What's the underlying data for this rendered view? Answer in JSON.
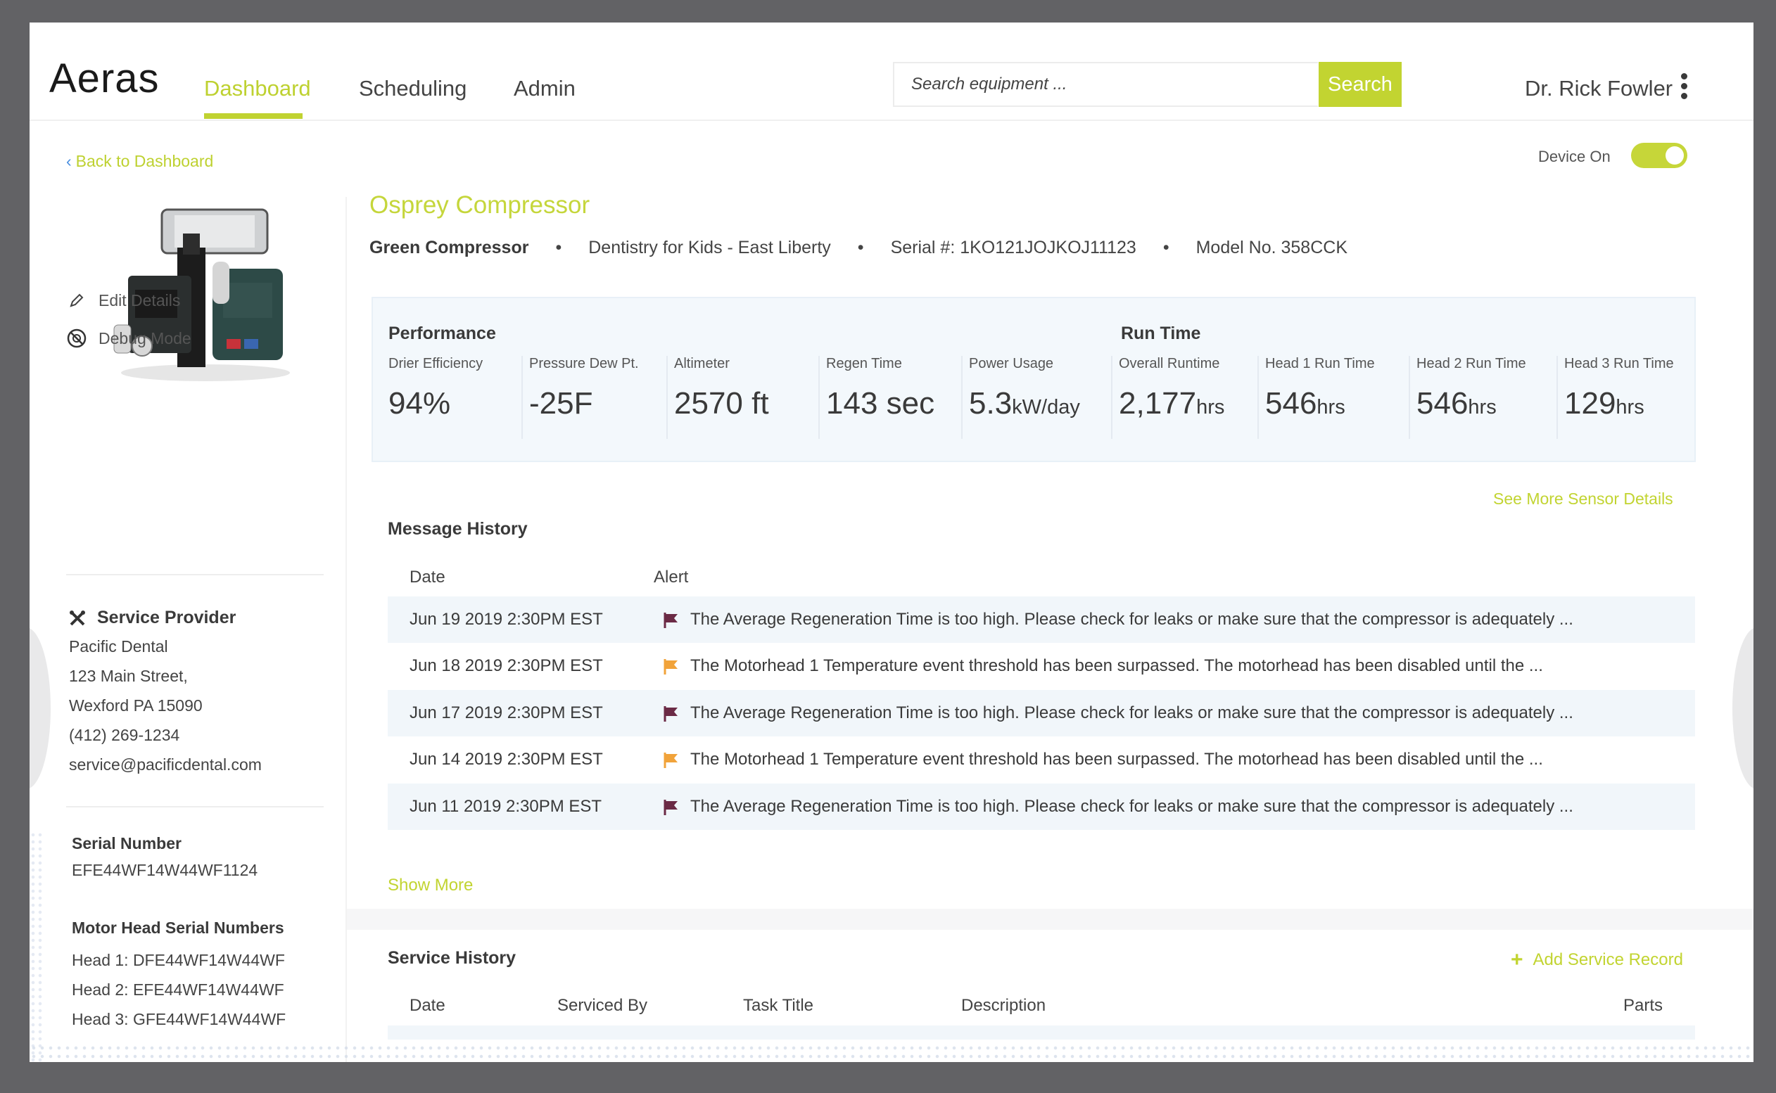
{
  "app": {
    "logo": "Aeras"
  },
  "nav": {
    "tabs": [
      {
        "label": "Dashboard"
      },
      {
        "label": "Scheduling"
      },
      {
        "label": "Admin"
      }
    ]
  },
  "search": {
    "placeholder": "Search equipment ...",
    "button": "Search"
  },
  "user": {
    "name": "Dr. Rick Fowler"
  },
  "back_link": "Back to Dashboard",
  "device": {
    "label": "Device On",
    "on": true
  },
  "product": {
    "title": "Osprey Compressor",
    "type": "Green Compressor",
    "location": "Dentistry for Kids - East Liberty",
    "serial": "Serial #: 1KO121JOJKOJ11123",
    "model": "Model No. 358CCK"
  },
  "left": {
    "edit": "Edit Details",
    "debug": "Debug Mode",
    "service_provider": {
      "title": "Service Provider",
      "lines": [
        "Pacific Dental",
        "123 Main Street,",
        "Wexford PA 15090",
        "(412) 269-1234",
        "service@pacificdental.com"
      ]
    },
    "serial_label": "Serial Number",
    "serial_value": "EFE44WF14W44WF1124",
    "motor_label": "Motor Head Serial Numbers",
    "motor_heads": [
      "Head 1: DFE44WF14W44WF",
      "Head 2: EFE44WF14W44WF",
      "Head 3: GFE44WF14W44WF"
    ]
  },
  "performance": {
    "title": "Performance",
    "runtime_title": "Run Time",
    "metrics": [
      {
        "label": "Drier Efficiency",
        "value": "94%",
        "unit": ""
      },
      {
        "label": "Pressure Dew Pt.",
        "value": "-25F",
        "unit": ""
      },
      {
        "label": "Altimeter",
        "value": "2570 ft",
        "unit": ""
      },
      {
        "label": "Regen Time",
        "value": "143 sec",
        "unit": ""
      },
      {
        "label": "Power Usage",
        "value": "5.3",
        "unit": "kW/day"
      },
      {
        "label": "Overall Runtime",
        "value": "2,177",
        "unit": "hrs"
      },
      {
        "label": "Head 1 Run Time",
        "value": "546",
        "unit": "hrs"
      },
      {
        "label": "Head 2 Run Time",
        "value": "546",
        "unit": "hrs"
      },
      {
        "label": "Head 3 Run Time",
        "value": "129",
        "unit": "hrs"
      }
    ]
  },
  "see_more": "See More Sensor Details",
  "messages": {
    "title": "Message History",
    "columns": [
      "Date",
      "Alert"
    ],
    "rows": [
      {
        "date": "Jun 19 2019 2:30PM EST",
        "flag": "#6b2a45",
        "text": "The Average Regeneration Time is too high. Please check for leaks or make sure that the compressor is adequately ..."
      },
      {
        "date": "Jun 18 2019 2:30PM EST",
        "flag": "#f1a33a",
        "text": "The Motorhead 1 Temperature event threshold has been surpassed. The motorhead has been disabled until the ..."
      },
      {
        "date": "Jun 17 2019 2:30PM EST",
        "flag": "#6b2a45",
        "text": "The Average Regeneration Time is too high. Please check for leaks or make sure that the compressor is adequately ..."
      },
      {
        "date": "Jun 14 2019 2:30PM EST",
        "flag": "#f1a33a",
        "text": "The Motorhead 1 Temperature event threshold has been surpassed. The motorhead has been disabled until the ..."
      },
      {
        "date": "Jun 11 2019 2:30PM EST",
        "flag": "#6b2a45",
        "text": "The Average Regeneration Time is too high. Please check for leaks or make sure that the compressor is adequately ..."
      }
    ],
    "show_more": "Show More"
  },
  "service": {
    "title": "Service History",
    "add": "Add Service Record",
    "columns": [
      "Date",
      "Serviced By",
      "Task Title",
      "Description",
      "Parts"
    ]
  },
  "colors": {
    "accent": "#c2d431",
    "flag_dark": "#6b2a45",
    "flag_orange": "#f1a33a"
  }
}
